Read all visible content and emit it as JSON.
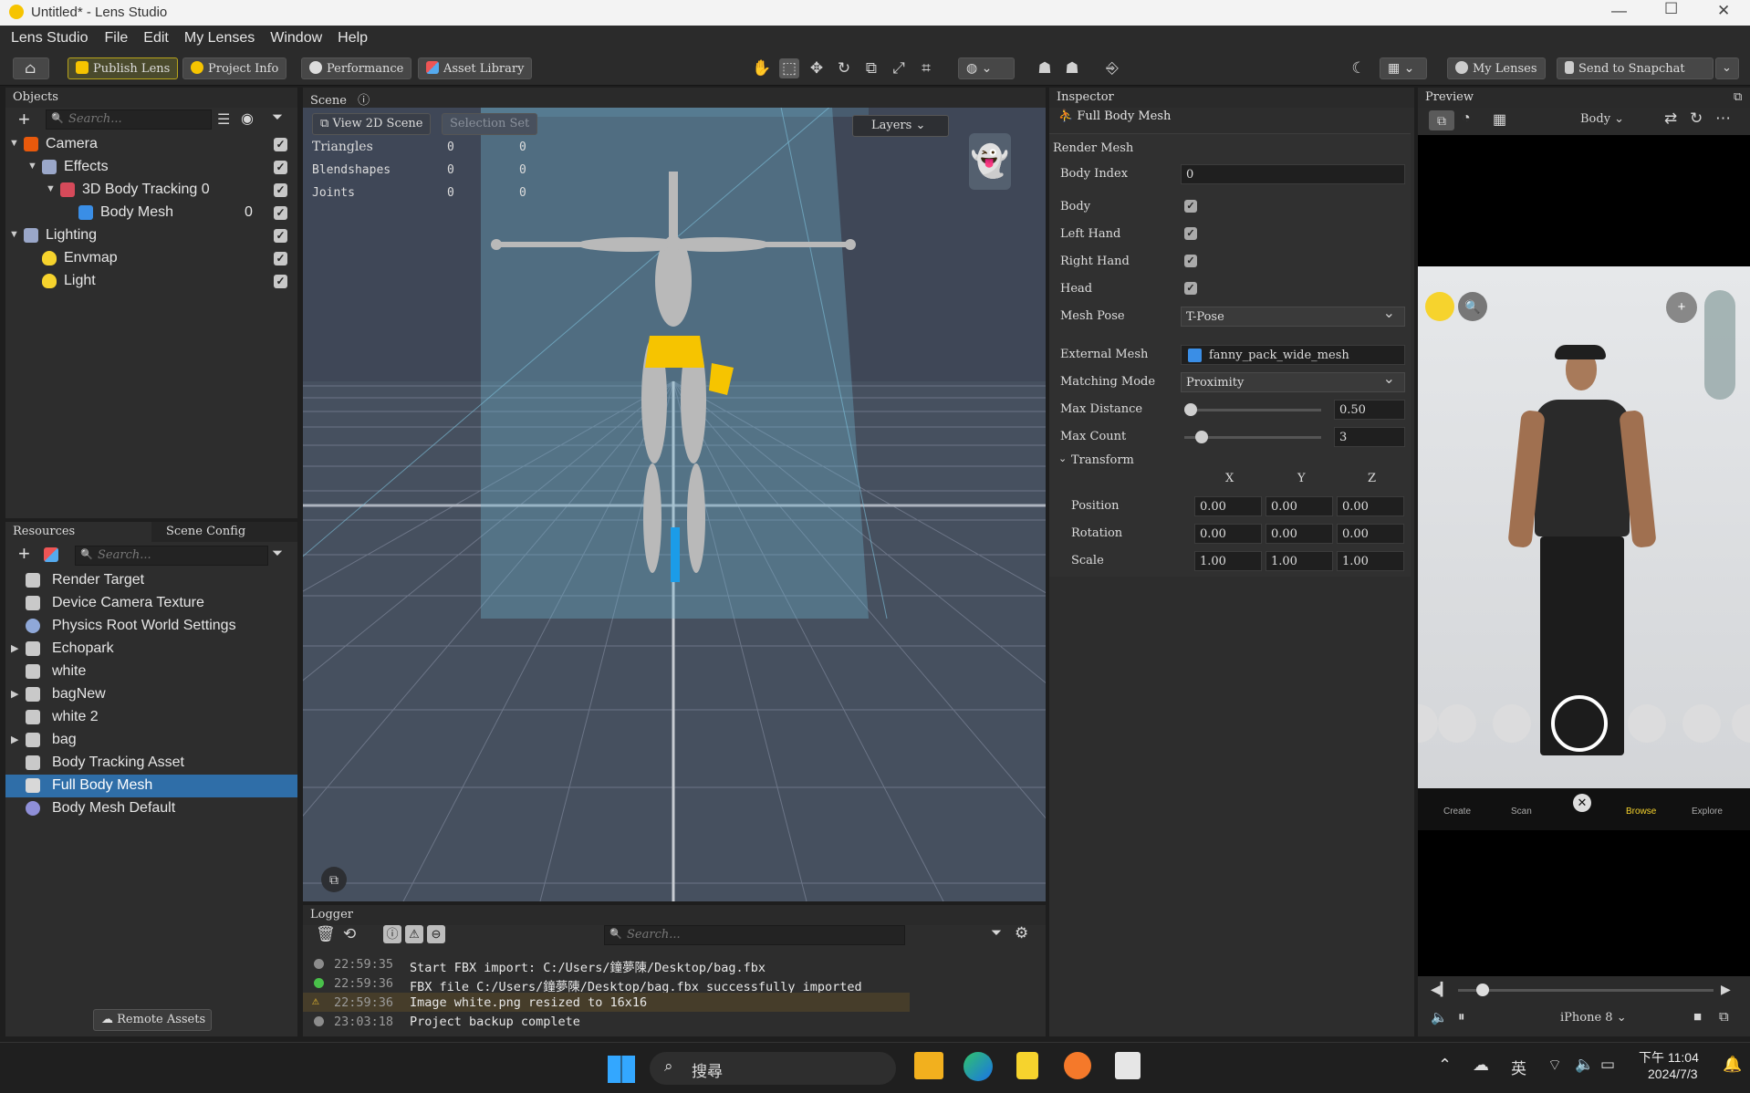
{
  "window": {
    "title": "Untitled* - Lens Studio"
  },
  "menu": [
    "Lens Studio",
    "File",
    "Edit",
    "My Lenses",
    "Window",
    "Help"
  ],
  "toolbar": {
    "publish": "Publish Lens",
    "project_info": "Project Info",
    "performance": "Performance",
    "asset_library": "Asset Library",
    "my_lenses": "My Lenses",
    "send_to_snapchat": "Send to Snapchat"
  },
  "objects": {
    "title": "Objects",
    "search_placeholder": "Search...",
    "items": [
      {
        "label": "Camera"
      },
      {
        "label": "Effects"
      },
      {
        "label": "3D Body Tracking 0"
      },
      {
        "label": "Body Mesh",
        "count": "0"
      },
      {
        "label": "Lighting"
      },
      {
        "label": "Envmap"
      },
      {
        "label": "Light"
      }
    ]
  },
  "resources": {
    "tab1": "Resources",
    "tab2": "Scene Config",
    "search_placeholder": "Search...",
    "items": [
      {
        "label": "Render Target"
      },
      {
        "label": "Device Camera Texture"
      },
      {
        "label": "Physics Root World Settings"
      },
      {
        "label": "Echopark"
      },
      {
        "label": "white"
      },
      {
        "label": "bagNew"
      },
      {
        "label": "white 2"
      },
      {
        "label": "bag"
      },
      {
        "label": "Body Tracking Asset"
      },
      {
        "label": "Full Body Mesh"
      },
      {
        "label": "Body Mesh Default"
      }
    ],
    "remote_assets": "Remote Assets"
  },
  "scene": {
    "title": "Scene",
    "view2d": "View 2D Scene",
    "selection_set": "Selection Set",
    "layers": "Layers",
    "stats": [
      {
        "label": "Triangles",
        "a": "0",
        "b": "0"
      },
      {
        "label": "Blendshapes",
        "a": "0",
        "b": "0"
      },
      {
        "label": "Joints",
        "a": "0",
        "b": "0"
      }
    ]
  },
  "logger": {
    "title": "Logger",
    "search_placeholder": "Search...",
    "rows": [
      {
        "time": "22:59:35",
        "text": "Start FBX import: C:/Users/鐘夢陳/Desktop/bag.fbx",
        "level": "info",
        "color": "#8c8c8c"
      },
      {
        "time": "22:59:36",
        "text": "FBX file C:/Users/鐘夢陳/Desktop/bag.fbx successfully imported",
        "level": "success",
        "color": "#49c04a"
      },
      {
        "time": "22:59:36",
        "text": "Image white.png resized to 16x16",
        "level": "warning",
        "color": "#f1c232"
      },
      {
        "time": "23:03:18",
        "text": "Project backup complete",
        "level": "info",
        "color": "#8c8c8c"
      }
    ]
  },
  "inspector": {
    "title": "Inspector",
    "object_name": "Full Body Mesh",
    "section": "Render Mesh",
    "body_index_label": "Body Index",
    "body_index": "0",
    "checks": [
      {
        "label": "Body",
        "checked": true
      },
      {
        "label": "Left Hand",
        "checked": true
      },
      {
        "label": "Right Hand",
        "checked": true
      },
      {
        "label": "Head",
        "checked": true
      }
    ],
    "mesh_pose_label": "Mesh Pose",
    "mesh_pose": "T-Pose",
    "external_mesh_label": "External Mesh",
    "external_mesh": "fanny_pack_wide_mesh",
    "matching_mode_label": "Matching Mode",
    "matching_mode": "Proximity",
    "max_distance_label": "Max Distance",
    "max_distance": "0.50",
    "max_count_label": "Max Count",
    "max_count": "3",
    "transform_label": "Transform",
    "axes": [
      "X",
      "Y",
      "Z"
    ],
    "transform": [
      {
        "label": "Position",
        "x": "0.00",
        "y": "0.00",
        "z": "0.00"
      },
      {
        "label": "Rotation",
        "x": "0.00",
        "y": "0.00",
        "z": "0.00"
      },
      {
        "label": "Scale",
        "x": "1.00",
        "y": "1.00",
        "z": "1.00"
      }
    ]
  },
  "preview": {
    "title": "Preview",
    "body_dropdown": "Body",
    "nav": [
      "Create",
      "Scan",
      "Browse",
      "Explore"
    ],
    "device": "iPhone 8"
  },
  "taskbar": {
    "search": "搜尋",
    "ime": "英",
    "time": "下午 11:04",
    "date": "2024/7/3"
  }
}
